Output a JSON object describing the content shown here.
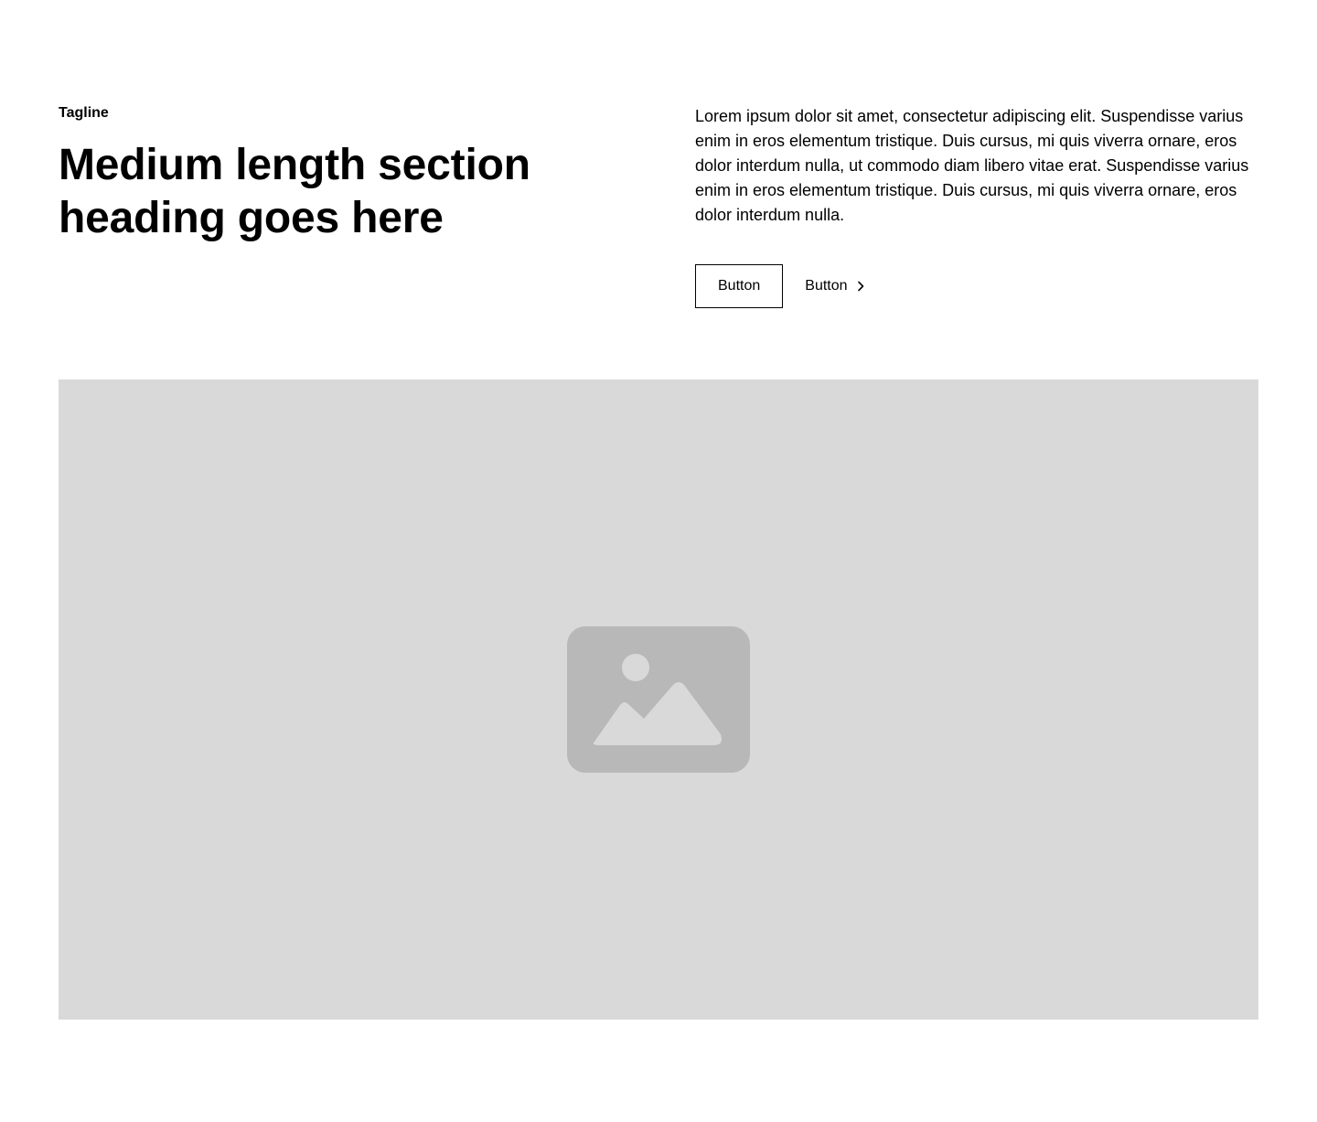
{
  "header": {
    "tagline": "Tagline",
    "heading": "Medium length section heading goes here"
  },
  "content": {
    "paragraph": "Lorem ipsum dolor sit amet, consectetur adipiscing elit. Suspendisse varius enim in eros elementum tristique. Duis cursus, mi quis viverra ornare, eros dolor interdum nulla, ut commodo diam libero vitae erat. Suspendisse varius enim in eros elementum tristique. Duis cursus, mi quis viverra ornare, eros dolor interdum nulla."
  },
  "actions": {
    "primary_label": "Button",
    "secondary_label": "Button",
    "secondary_icon": "chevron-right-icon"
  },
  "media": {
    "icon": "image-icon",
    "placeholder_color": "#d9d9d9",
    "icon_color": "#b8b8b8"
  }
}
